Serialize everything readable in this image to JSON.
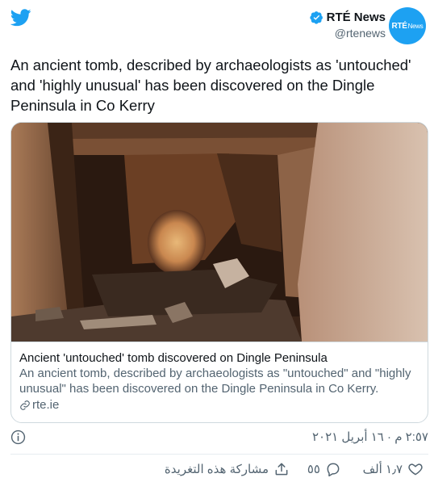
{
  "header": {
    "author_name": "RTÉ News",
    "author_handle": "@rtenews",
    "avatar_text_bold": "RTÉ",
    "avatar_text_light": "News",
    "logo_icon": "twitter-bird-icon",
    "verified_icon": "verified-badge-icon"
  },
  "tweet": {
    "text": "An ancient tomb, described by archaeologists as 'untouched' and 'highly unusual' has been discovered on the Dingle Peninsula in Co Kerry"
  },
  "card": {
    "title": "Ancient 'untouched' tomb discovered on Dingle Peninsula",
    "description": "An ancient tomb, described by archaeologists as \"untouched\" and \"highly unusual\" has been discovered on the Dingle Peninsula in Co Kerry.",
    "domain": "rte.ie",
    "link_icon": "link-icon"
  },
  "meta": {
    "timestamp": "٢:٥٧ م · ١٦ أبريل ٢٠٢١",
    "info_icon": "info-icon"
  },
  "actions": {
    "like_count": "١٫٧ ألف",
    "reply_count": "٥٥",
    "share_label": "مشاركة هذه التغريدة"
  },
  "colors": {
    "brand_blue": "#1da1f2",
    "text_primary": "#0f1419",
    "text_secondary": "#536471",
    "border": "#cfd9de"
  }
}
